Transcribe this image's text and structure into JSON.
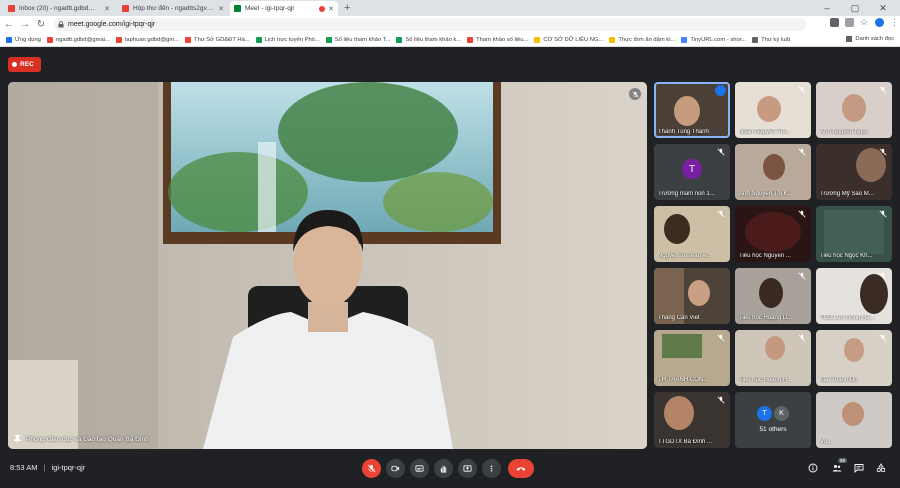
{
  "browser": {
    "tabs": [
      {
        "title": "Inbox (20) - ngadtt.gdbd@gmai...",
        "icon": "gmail-icon",
        "color": "#ea4335"
      },
      {
        "title": "Hộp thư đến - ngadtts2gv@sc...",
        "icon": "gmail-icon",
        "color": "#ea4335"
      },
      {
        "title": "Meet - igi-tpqr-qjr",
        "icon": "meet-icon",
        "color": "#00832d"
      }
    ],
    "url": "meet.google.com/igi-tpqr-qjr",
    "bookmarks": [
      {
        "label": "Ứng dụng",
        "color": "#1a73e8"
      },
      {
        "label": "ngadtt.gdbd@gmai...",
        "color": "#ea4335"
      },
      {
        "label": "taphuan.gdbd@gm...",
        "color": "#ea4335"
      },
      {
        "label": "Thư Sở GD&ĐT Hà...",
        "color": "#ea4335"
      },
      {
        "label": "Lịch trực tuyến Phò...",
        "color": "#0f9d58"
      },
      {
        "label": "Số liệu tham khảo T...",
        "color": "#0f9d58"
      },
      {
        "label": "Số liệu tham khảo k...",
        "color": "#0f9d58"
      },
      {
        "label": "Tham khảo số liệu...",
        "color": "#ea4335"
      },
      {
        "label": "CƠ SỞ DỮ LIỆU NG...",
        "color": "#fbbc04"
      },
      {
        "label": "Thực đơn ăn dặm ki...",
        "color": "#fbbc04"
      },
      {
        "label": "TinyURL.com - shor...",
        "color": "#4285f4"
      },
      {
        "label": "Thư ký luật",
        "color": "#5f6368"
      }
    ],
    "reading_list": "Danh sách đọc"
  },
  "meet": {
    "rec_label": "REC",
    "main_speaker_name": "Phòng Giáo dục và Đào tạo Quận Ba Đình",
    "participants": [
      {
        "name": "Thanh Tùng Thành",
        "bg": "#4a4038",
        "speaking": true
      },
      {
        "name": "Ngân Nguyễn Thị...",
        "bg": "#e6dfd5",
        "speaking": false
      },
      {
        "name": "Anh Nguyễn Ngọc",
        "bg": "#d8cfca",
        "speaking": false
      },
      {
        "name": "Trường mầm non 1...",
        "bg": "#3c4043",
        "avatar": "T",
        "avatar_color": "#7b1fa2",
        "speaking": false
      },
      {
        "name": "Anh Nguyễn Thị K...",
        "bg": "#b9a99b",
        "speaking": false
      },
      {
        "name": "Trương Mỹ Sao M...",
        "bg": "#3b2f2b",
        "speaking": false
      },
      {
        "name": "Nguyễn Thị Vân A...",
        "bg": "#cdbfa5",
        "speaking": false
      },
      {
        "name": "Tiểu học Nguyễn ...",
        "bg": "#2a1414",
        "speaking": false
      },
      {
        "name": "Tiểu học Ngọc Kh...",
        "bg": "#385248",
        "speaking": false
      },
      {
        "name": "Thang Can Viet",
        "bg": "#4e4339",
        "speaking": false
      },
      {
        "name": "Tiểu học Hoàng D...",
        "bg": "#a8a29a",
        "speaking": false
      },
      {
        "name": "TCB Lưu Hồng Ha...",
        "bg": "#e5e1dd",
        "speaking": false
      },
      {
        "name": "TH THÀNH CÔN...",
        "bg": "#b6a98f",
        "speaking": false
      },
      {
        "name": "Tiểu học Hoàng H...",
        "bg": "#cfc6ba",
        "speaking": false
      },
      {
        "name": "Mai Thanh Do",
        "bg": "#d7d0c6",
        "speaking": false
      },
      {
        "name": "TTGDTX Ba Đình ...",
        "bg": "#3a3430",
        "speaking": false
      },
      {
        "name": "Vo...",
        "bg": "#cfcac5",
        "speaking": false
      }
    ],
    "others": {
      "label": "51 others",
      "avatars": [
        {
          "letter": "T",
          "color": "#1a73e8"
        },
        {
          "letter": "K",
          "color": "#5f6368"
        }
      ]
    },
    "time": "8:53 AM",
    "meeting_code": "igi-tpqr-qjr",
    "people_count": "69"
  }
}
